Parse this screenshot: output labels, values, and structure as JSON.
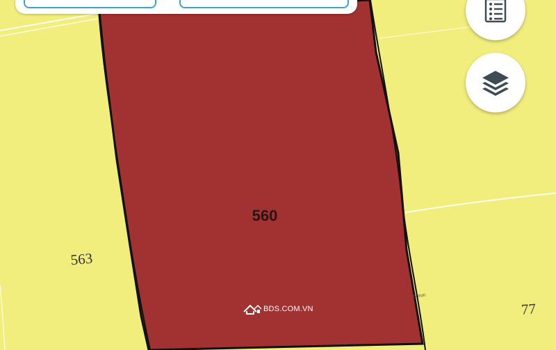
{
  "map": {
    "parcels": {
      "selected_number": "560",
      "west_number": "563",
      "east_number": "77",
      "small_text": "5 mm"
    },
    "colors": {
      "background": "#f2ee7d",
      "selected_fill": "#a23131",
      "boundary": "#111111",
      "light_boundary": "#ffffff"
    }
  },
  "controls": {
    "list_icon": "document-list-icon",
    "layers_icon": "layers-icon"
  },
  "watermark": {
    "icon": "house-icon",
    "text": "BDS.COM.VN"
  }
}
